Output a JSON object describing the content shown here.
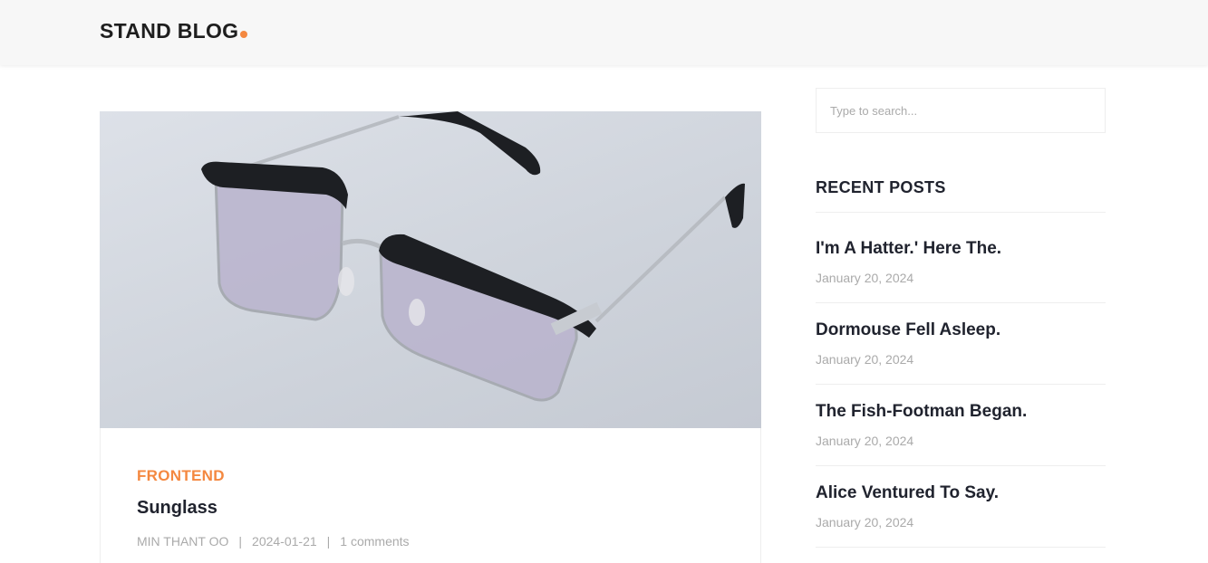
{
  "header": {
    "logo_text": "STAND BLOG",
    "accent_color": "#f48840"
  },
  "post": {
    "image_alt": "Sunglass",
    "category": "FRONTEND",
    "title": "Sunglass",
    "author": "MIN THANT OO",
    "date": "2024-01-21",
    "comments": "1 comments"
  },
  "sidebar": {
    "search_placeholder": "Type to search...",
    "recent_heading": "RECENT POSTS",
    "recent_posts": [
      {
        "title": "I'm A Hatter.' Here The.",
        "date": "January 20, 2024"
      },
      {
        "title": "Dormouse Fell Asleep.",
        "date": "January 20, 2024"
      },
      {
        "title": "The Fish-Footman Began.",
        "date": "January 20, 2024"
      },
      {
        "title": "Alice Ventured To Say.",
        "date": "January 20, 2024"
      }
    ]
  }
}
